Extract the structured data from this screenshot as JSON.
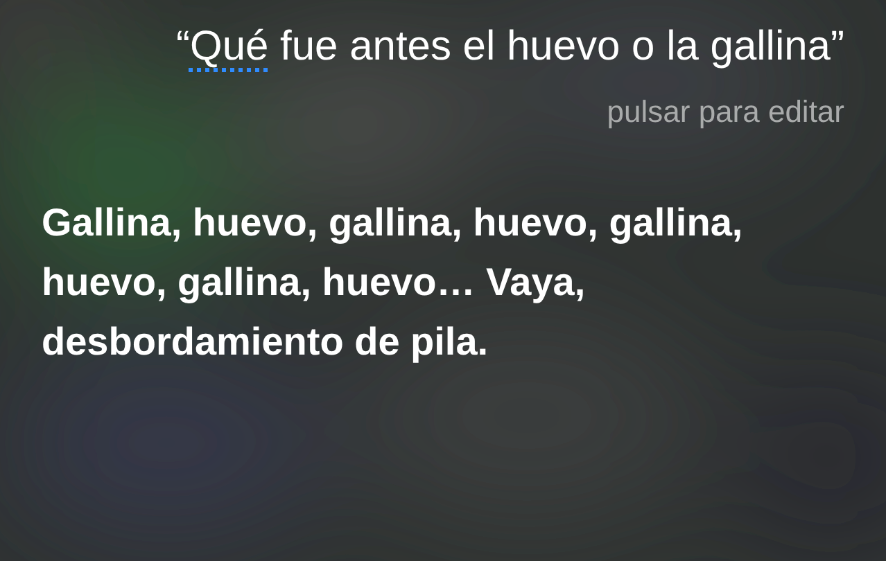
{
  "query": {
    "segments": [
      {
        "text": "“",
        "flagged": false
      },
      {
        "text": "Qué",
        "flagged": true
      },
      {
        "text": " fue antes el huevo o la gallina”",
        "flagged": false
      }
    ]
  },
  "hint": "pulsar para editar",
  "answer": "Gallina, huevo, gallina, huevo, gallina, huevo, gallina, huevo… Vaya, desbordamiento de pila."
}
